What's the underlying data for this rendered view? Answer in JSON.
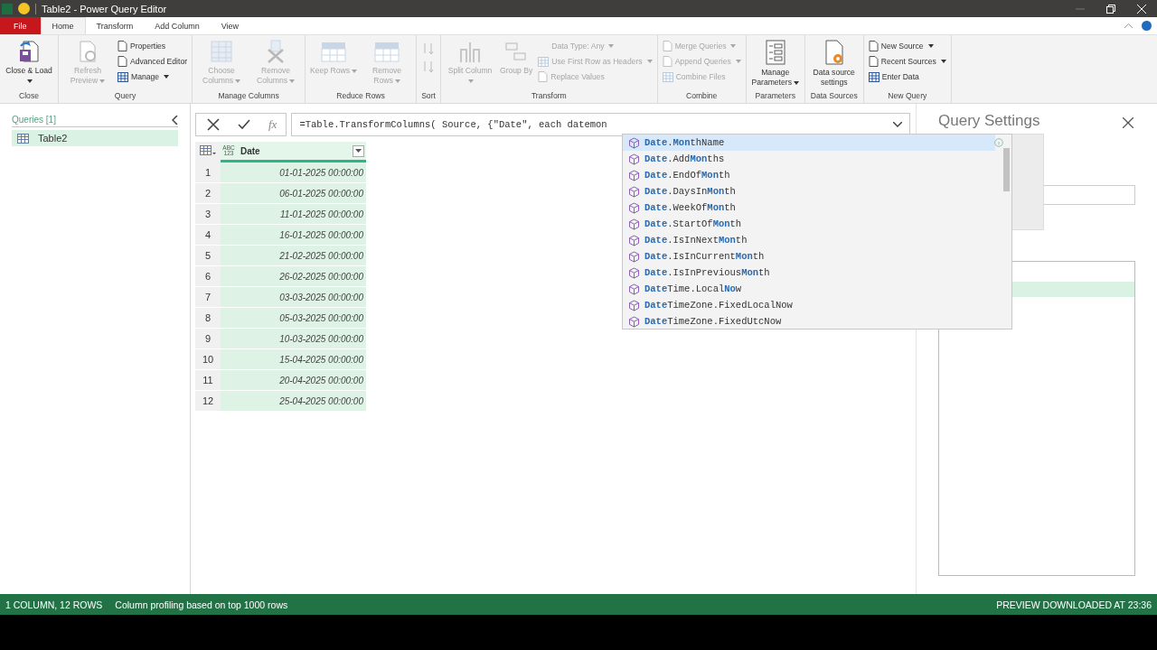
{
  "window": {
    "title": "Table2 - Power Query Editor"
  },
  "tabs": [
    {
      "label": "File",
      "kind": "file",
      "selected": false
    },
    {
      "label": "Home",
      "kind": "tab",
      "selected": true
    },
    {
      "label": "Transform",
      "kind": "tab",
      "selected": false
    },
    {
      "label": "Add Column",
      "kind": "tab",
      "selected": false
    },
    {
      "label": "View",
      "kind": "tab",
      "selected": false
    }
  ],
  "ribbon": {
    "groups": [
      {
        "label": "Close",
        "items": [
          {
            "kind": "large",
            "label": "Close & Load",
            "dropdown": true,
            "disabled": false
          }
        ]
      },
      {
        "label": "Query",
        "items": [
          {
            "kind": "large",
            "label": "Refresh Preview",
            "dropdown": true,
            "disabled": true
          },
          {
            "kind": "stack",
            "items": [
              {
                "label": "Properties",
                "dropdown": false,
                "disabled": false
              },
              {
                "label": "Advanced Editor",
                "dropdown": false,
                "disabled": false
              },
              {
                "label": "Manage",
                "dropdown": true,
                "disabled": false
              }
            ]
          }
        ]
      },
      {
        "label": "Manage Columns",
        "items": [
          {
            "kind": "large",
            "label": "Choose Columns",
            "dropdown": true,
            "disabled": true
          },
          {
            "kind": "large",
            "label": "Remove Columns",
            "dropdown": true,
            "disabled": true
          }
        ]
      },
      {
        "label": "Reduce Rows",
        "items": [
          {
            "kind": "large",
            "label": "Keep Rows",
            "dropdown": true,
            "disabled": true
          },
          {
            "kind": "large",
            "label": "Remove Rows",
            "dropdown": true,
            "disabled": true
          }
        ]
      },
      {
        "label": "Sort",
        "items": [
          {
            "kind": "sort",
            "disabled": true
          }
        ]
      },
      {
        "label": "Transform",
        "items": [
          {
            "kind": "large",
            "label": "Split Column",
            "dropdown": true,
            "disabled": true
          },
          {
            "kind": "large",
            "label": "Group By",
            "dropdown": false,
            "disabled": true
          },
          {
            "kind": "stack",
            "items": [
              {
                "label": "Data Type: Any",
                "dropdown": true,
                "disabled": true
              },
              {
                "label": "Use First Row as Headers",
                "dropdown": true,
                "disabled": true
              },
              {
                "label": "Replace Values",
                "dropdown": false,
                "disabled": true
              }
            ]
          }
        ]
      },
      {
        "label": "Combine",
        "items": [
          {
            "kind": "stack",
            "items": [
              {
                "label": "Merge Queries",
                "dropdown": true,
                "disabled": true
              },
              {
                "label": "Append Queries",
                "dropdown": true,
                "disabled": true
              },
              {
                "label": "Combine Files",
                "dropdown": false,
                "disabled": true
              }
            ]
          }
        ]
      },
      {
        "label": "Parameters",
        "items": [
          {
            "kind": "large",
            "label": "Manage Parameters",
            "dropdown": true,
            "disabled": false
          }
        ]
      },
      {
        "label": "Data Sources",
        "items": [
          {
            "kind": "large",
            "label": "Data source settings",
            "dropdown": false,
            "disabled": false
          }
        ]
      },
      {
        "label": "New Query",
        "items": [
          {
            "kind": "stack",
            "items": [
              {
                "label": "New Source",
                "dropdown": true,
                "disabled": false
              },
              {
                "label": "Recent Sources",
                "dropdown": true,
                "disabled": false
              },
              {
                "label": "Enter Data",
                "dropdown": false,
                "disabled": false
              }
            ]
          }
        ]
      }
    ]
  },
  "queries": {
    "header": "Queries [1]",
    "items": [
      {
        "label": "Table2",
        "selected": true
      }
    ]
  },
  "formula_bar": {
    "fx": "fx",
    "value": "=Table.TransformColumns( Source, {\"Date\", each datemon"
  },
  "table": {
    "type_label": "ABC 123",
    "columns": [
      "Date"
    ],
    "rows": [
      {
        "n": "1",
        "value": "01-01-2025 00:00:00"
      },
      {
        "n": "2",
        "value": "06-01-2025 00:00:00"
      },
      {
        "n": "3",
        "value": "11-01-2025 00:00:00"
      },
      {
        "n": "4",
        "value": "16-01-2025 00:00:00"
      },
      {
        "n": "5",
        "value": "21-02-2025 00:00:00"
      },
      {
        "n": "6",
        "value": "26-02-2025 00:00:00"
      },
      {
        "n": "7",
        "value": "03-03-2025 00:00:00"
      },
      {
        "n": "8",
        "value": "05-03-2025 00:00:00"
      },
      {
        "n": "9",
        "value": "10-03-2025 00:00:00"
      },
      {
        "n": "10",
        "value": "15-04-2025 00:00:00"
      },
      {
        "n": "11",
        "value": "20-04-2025 00:00:00"
      },
      {
        "n": "12",
        "value": "25-04-2025 00:00:00"
      }
    ]
  },
  "suggestions": [
    {
      "selected": true,
      "parts": [
        {
          "text": "Date",
          "match": true
        },
        {
          "text": ".",
          "match": false
        },
        {
          "text": "Mon",
          "match": true
        },
        {
          "text": "thName",
          "match": false
        }
      ]
    },
    {
      "selected": false,
      "parts": [
        {
          "text": "Date",
          "match": true
        },
        {
          "text": ".Add",
          "match": false
        },
        {
          "text": "Mon",
          "match": true
        },
        {
          "text": "ths",
          "match": false
        }
      ]
    },
    {
      "selected": false,
      "parts": [
        {
          "text": "Date",
          "match": true
        },
        {
          "text": ".EndOf",
          "match": false
        },
        {
          "text": "Mon",
          "match": true
        },
        {
          "text": "th",
          "match": false
        }
      ]
    },
    {
      "selected": false,
      "parts": [
        {
          "text": "Date",
          "match": true
        },
        {
          "text": ".DaysIn",
          "match": false
        },
        {
          "text": "Mon",
          "match": true
        },
        {
          "text": "th",
          "match": false
        }
      ]
    },
    {
      "selected": false,
      "parts": [
        {
          "text": "Date",
          "match": true
        },
        {
          "text": ".WeekOf",
          "match": false
        },
        {
          "text": "Mon",
          "match": true
        },
        {
          "text": "th",
          "match": false
        }
      ]
    },
    {
      "selected": false,
      "parts": [
        {
          "text": "Date",
          "match": true
        },
        {
          "text": ".StartOf",
          "match": false
        },
        {
          "text": "Mon",
          "match": true
        },
        {
          "text": "th",
          "match": false
        }
      ]
    },
    {
      "selected": false,
      "parts": [
        {
          "text": "Date",
          "match": true
        },
        {
          "text": ".IsInNext",
          "match": false
        },
        {
          "text": "Mon",
          "match": true
        },
        {
          "text": "th",
          "match": false
        }
      ]
    },
    {
      "selected": false,
      "parts": [
        {
          "text": "Date",
          "match": true
        },
        {
          "text": ".IsInCurrent",
          "match": false
        },
        {
          "text": "Mon",
          "match": true
        },
        {
          "text": "th",
          "match": false
        }
      ]
    },
    {
      "selected": false,
      "parts": [
        {
          "text": "Date",
          "match": true
        },
        {
          "text": ".IsInPrevious",
          "match": false
        },
        {
          "text": "Mon",
          "match": true
        },
        {
          "text": "th",
          "match": false
        }
      ]
    },
    {
      "selected": false,
      "parts": [
        {
          "text": "Date",
          "match": true
        },
        {
          "text": "Time.Local",
          "match": false
        },
        {
          "text": "No",
          "match": true
        },
        {
          "text": "w",
          "match": false
        }
      ]
    },
    {
      "selected": false,
      "parts": [
        {
          "text": "Date",
          "match": true
        },
        {
          "text": "TimeZone.FixedLocalNow",
          "match": false
        }
      ]
    },
    {
      "selected": false,
      "parts": [
        {
          "text": "Date",
          "match": true
        },
        {
          "text": "TimeZone.FixedUtcNow",
          "match": false
        }
      ]
    }
  ],
  "settings": {
    "title": "Query Settings"
  },
  "status_bar": {
    "left": [
      "1 COLUMN, 12 ROWS",
      "Column profiling based on top 1000 rows"
    ],
    "right": "PREVIEW DOWNLOADED AT 23:36"
  }
}
